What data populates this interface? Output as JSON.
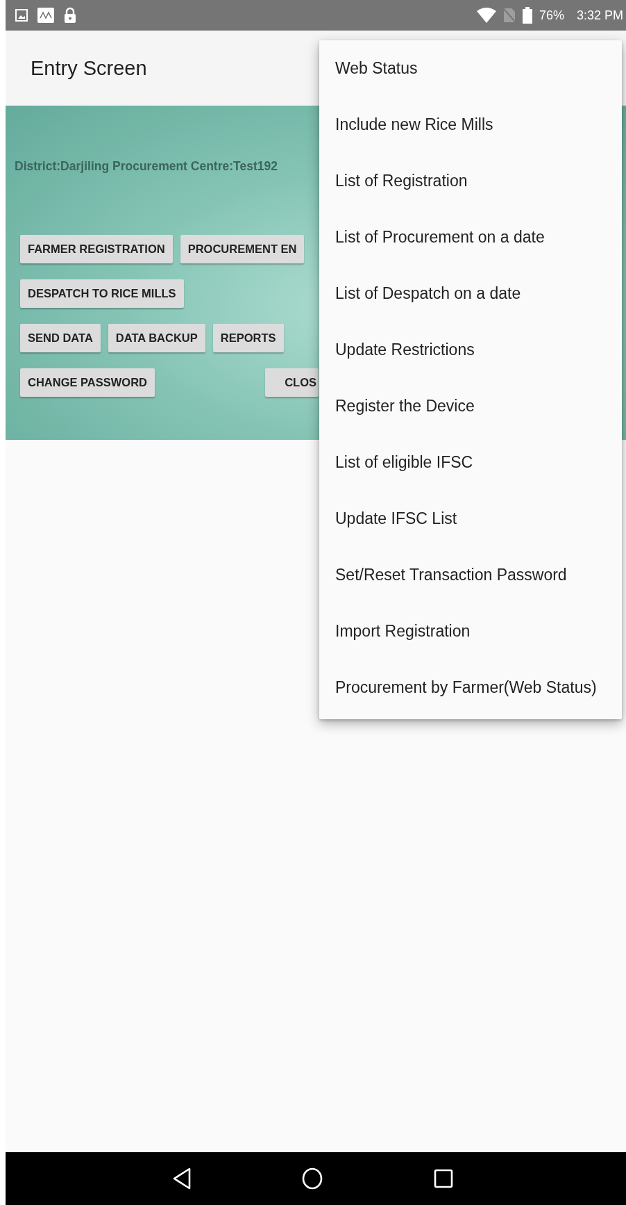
{
  "status_bar": {
    "battery": "76%",
    "time": "3:32 PM"
  },
  "app_bar": {
    "title": "Entry Screen"
  },
  "panel": {
    "info": "District:Darjiling Procurement Centre:Test192",
    "button_rows": [
      [
        "FARMER REGISTRATION",
        "PROCUREMENT EN"
      ],
      [
        "DESPATCH TO RICE MILLS"
      ],
      [
        "SEND DATA",
        "DATA BACKUP",
        "REPORTS"
      ],
      [
        "CHANGE PASSWORD",
        "CLOS"
      ]
    ]
  },
  "menu": {
    "items": [
      "Web Status",
      "Include new Rice Mills",
      "List of Registration",
      "List of Procurement on a date",
      "List of Despatch on a date",
      "Update Restrictions",
      "Register the Device",
      "List of eligible IFSC",
      "Update IFSC List",
      "Set/Reset Transaction Password",
      "Import Registration",
      "Procurement by Farmer(Web Status)"
    ]
  }
}
